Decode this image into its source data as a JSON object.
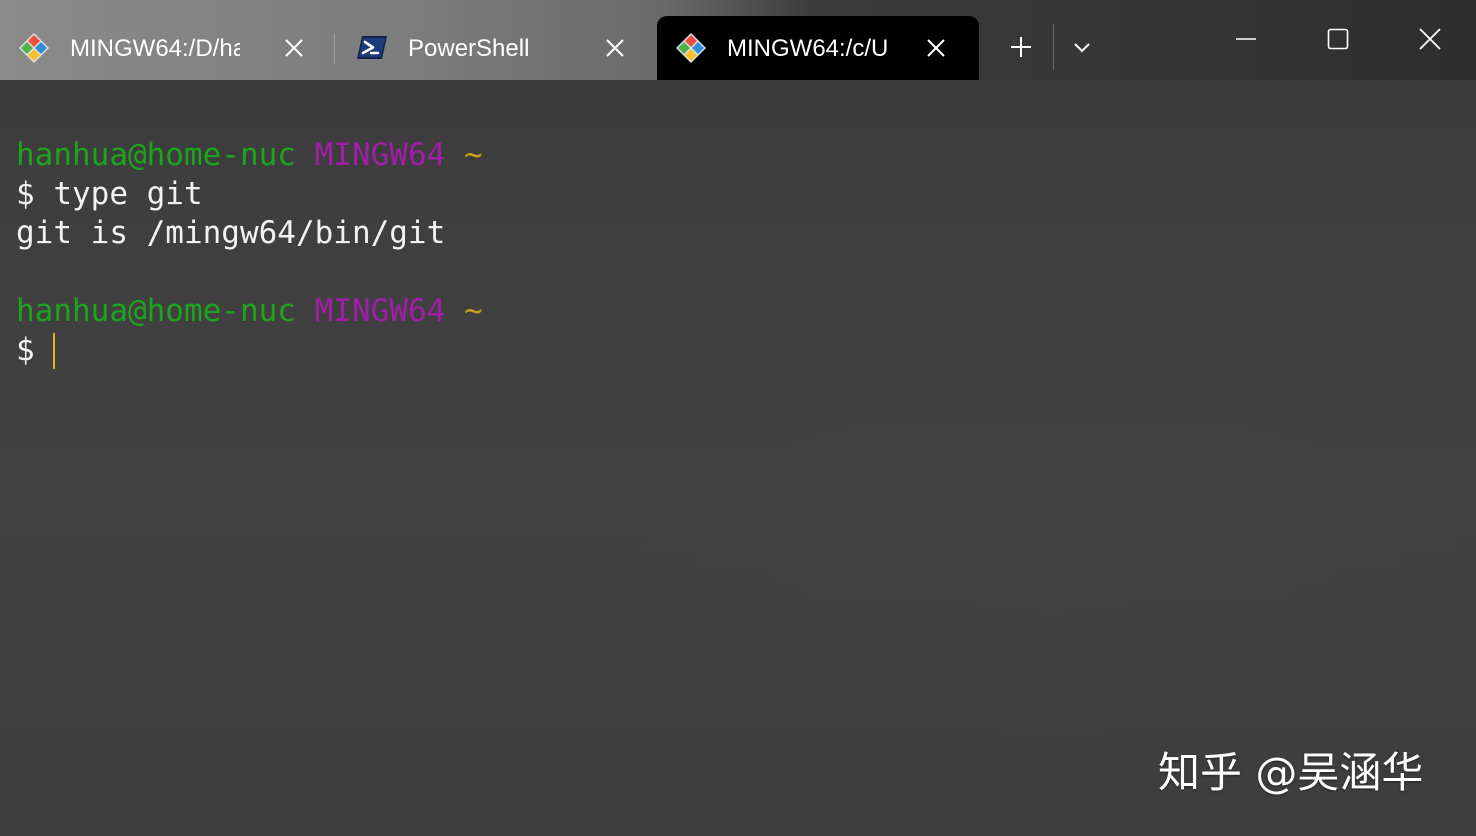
{
  "tabs": [
    {
      "title": "MINGW64:/D/ha",
      "icon": "git-bash-icon",
      "active": false
    },
    {
      "title": "PowerShell",
      "icon": "powershell-icon",
      "active": false
    },
    {
      "title": "MINGW64:/c/U",
      "icon": "git-bash-icon",
      "active": true
    }
  ],
  "toolbar": {
    "new_tab_icon": "plus-icon",
    "dropdown_icon": "chevron-down-icon"
  },
  "window_controls": {
    "minimize_icon": "minimize-icon",
    "maximize_icon": "maximize-icon",
    "close_icon": "close-icon"
  },
  "terminal": {
    "prompt1": {
      "user_host": "hanhua@home-nuc",
      "system": "MINGW64",
      "dir": "~"
    },
    "command_line": "$ type git",
    "output_line": "git is /mingw64/bin/git",
    "prompt2": {
      "user_host": "hanhua@home-nuc",
      "system": "MINGW64",
      "dir": "~"
    },
    "input_prefix": "$ "
  },
  "watermark": "知乎 @吴涵华",
  "colors": {
    "user_host": "#1ea31e",
    "system": "#a21ea8",
    "dir": "#c7a11c",
    "cursor": "#e6b422",
    "text": "#f2f2f2",
    "active_tab": "#000000"
  }
}
